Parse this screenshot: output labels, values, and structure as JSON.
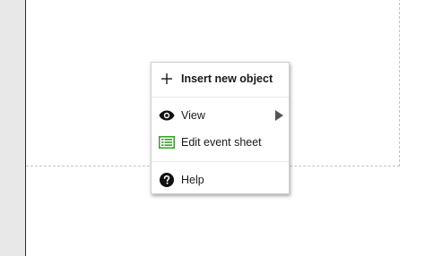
{
  "context_menu": {
    "items": [
      {
        "label": "Insert new object",
        "icon": "plus-icon",
        "bold": true
      },
      {
        "label": "View",
        "icon": "eye-icon",
        "has_submenu": true
      },
      {
        "label": "Edit event sheet",
        "icon": "event-sheet-icon"
      },
      {
        "label": "Help",
        "icon": "help-icon"
      }
    ]
  },
  "colors": {
    "menu_background": "#ffffff",
    "left_panel": "#e8e8e8",
    "event_sheet_icon": "#3a9a2f",
    "dashed_bounds": "#c4c4c4"
  }
}
